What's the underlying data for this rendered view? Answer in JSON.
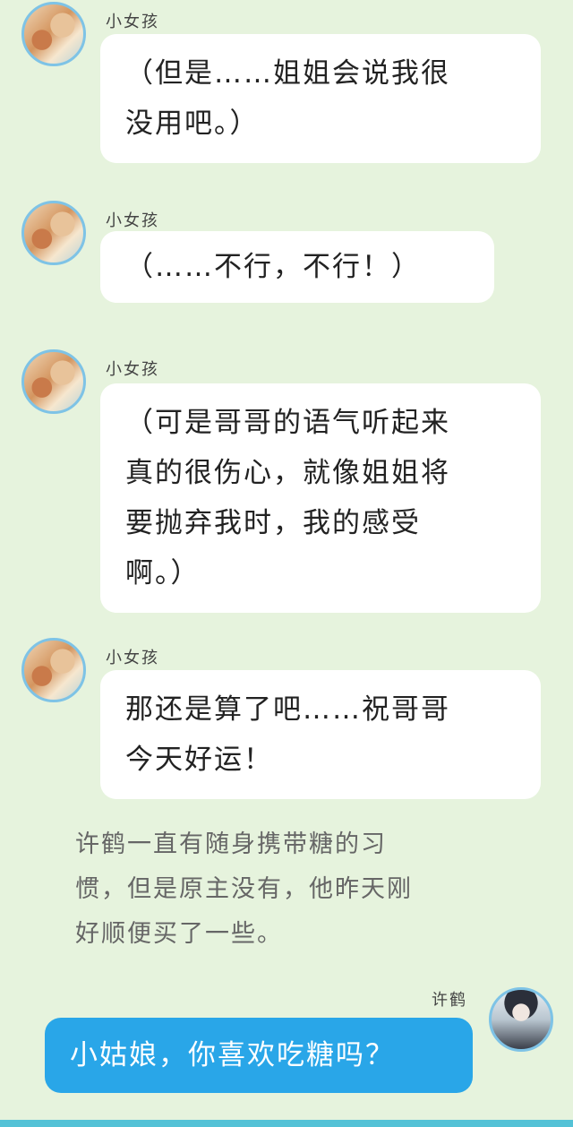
{
  "colors": {
    "background": "#e6f3dd",
    "bubble_left": "#ffffff",
    "bubble_right": "#29a6e8",
    "avatar_ring": "#7ec3e6",
    "bottom_bar": "#54c2d6"
  },
  "messages": [
    {
      "sender": "小女孩",
      "lines": [
        "（但是……姐姐会说我很",
        "没用吧。）"
      ]
    },
    {
      "sender": "小女孩",
      "lines": [
        "（……不行，不行！）"
      ]
    },
    {
      "sender": "小女孩",
      "lines": [
        "（可是哥哥的语气听起来",
        "真的很伤心，就像姐姐将",
        "要抛弃我时，我的感受",
        "啊。）"
      ]
    },
    {
      "sender": "小女孩",
      "lines": [
        "那还是算了吧……祝哥哥",
        "今天好运！"
      ]
    }
  ],
  "narration": {
    "lines": [
      "许鹤一直有随身携带糖的习",
      "惯，但是原主没有，他昨天刚",
      "好顺便买了一些。"
    ]
  },
  "reply": {
    "sender": "许鹤",
    "lines": [
      "小姑娘，你喜欢吃糖吗？"
    ]
  }
}
